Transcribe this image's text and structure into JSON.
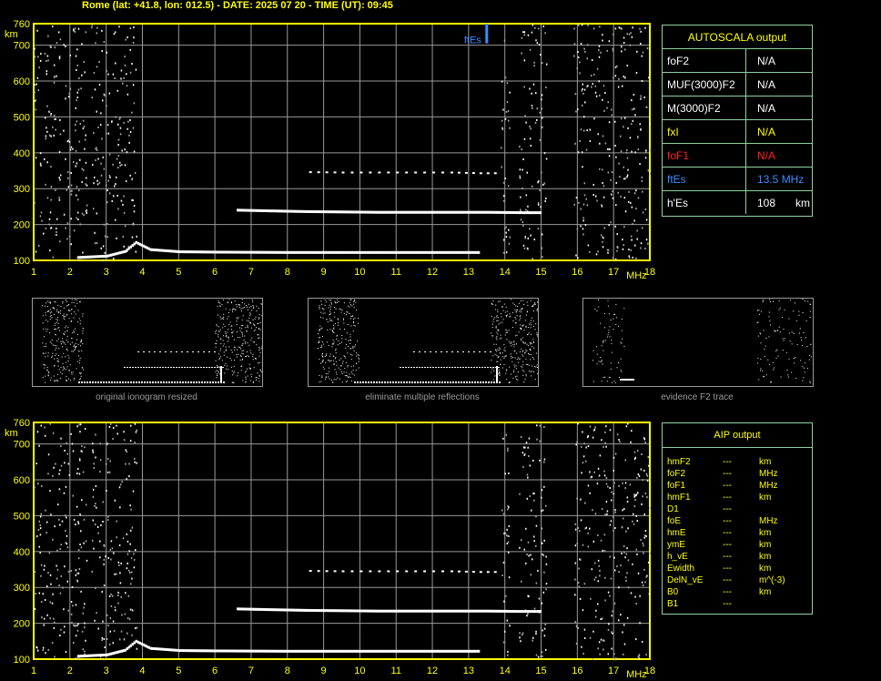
{
  "header": {
    "title": "Rome (lat: +41.8, lon: 012.5) - DATE: 2025 07 20 - TIME (UT): 09:45"
  },
  "colors": {
    "axis": "#ffff00",
    "grid": "#9a9a9a",
    "panel_border": "#8fd19e",
    "red": "#ff2020",
    "blue": "#3a8cff"
  },
  "autoscala": {
    "title": "AUTOSCALA output",
    "rows": [
      {
        "label": "foF2",
        "value": "N/A",
        "unit": "",
        "color": "#ffffff"
      },
      {
        "label": "MUF(3000)F2",
        "value": "N/A",
        "unit": "",
        "color": "#ffffff"
      },
      {
        "label": "M(3000)F2",
        "value": "N/A",
        "unit": "",
        "color": "#ffffff"
      },
      {
        "label": "fxI",
        "value": "N/A",
        "unit": "",
        "color": "#ffff00"
      },
      {
        "label": "foF1",
        "value": "N/A",
        "unit": "",
        "color": "#ff2020"
      },
      {
        "label": "ftEs",
        "value": "13.5 MHz",
        "unit": "",
        "color": "#3a8cff"
      },
      {
        "label": "h'Es",
        "value": "108",
        "unit": "km",
        "color": "#ffffff"
      }
    ]
  },
  "aip": {
    "title": "AIP output",
    "rows": [
      {
        "name": "hmF2",
        "value": "---",
        "unit": "km"
      },
      {
        "name": "foF2",
        "value": "---",
        "unit": "MHz"
      },
      {
        "name": "foF1",
        "value": "---",
        "unit": "MHz"
      },
      {
        "name": "hmF1",
        "value": "---",
        "unit": "km"
      },
      {
        "name": "D1",
        "value": "---",
        "unit": ""
      },
      {
        "name": "foE",
        "value": "---",
        "unit": "MHz"
      },
      {
        "name": "hmE",
        "value": "---",
        "unit": "km"
      },
      {
        "name": "ymE",
        "value": "---",
        "unit": "km"
      },
      {
        "name": "h_vE",
        "value": "---",
        "unit": "km"
      },
      {
        "name": "Ewidth",
        "value": "---",
        "unit": "km"
      },
      {
        "name": "DelN_vE",
        "value": "---",
        "unit": "m^(-3)"
      },
      {
        "name": "B0",
        "value": "---",
        "unit": "km"
      },
      {
        "name": "B1",
        "value": "---",
        "unit": ""
      }
    ]
  },
  "thumbnails": [
    {
      "caption": "original ionogram resized"
    },
    {
      "caption": "eliminate multiple reflections"
    },
    {
      "caption": "evidence F2 trace"
    }
  ],
  "chart_data": [
    {
      "type": "scatter",
      "panel": "autoscala-ionogram",
      "xlabel": "MHz",
      "ylabel": "km",
      "xlim": [
        1,
        18
      ],
      "ylim": [
        100,
        760
      ],
      "x_ticks": [
        1,
        2,
        3,
        4,
        5,
        6,
        7,
        8,
        9,
        10,
        11,
        12,
        13,
        14,
        15,
        16,
        17,
        18
      ],
      "y_ticks": [
        100,
        200,
        300,
        400,
        500,
        600,
        700,
        760
      ],
      "grid": true,
      "annotations": [
        {
          "text": "ftEs",
          "x": 13.5,
          "y": 700
        }
      ],
      "series": [
        {
          "values_x": [
            2.2,
            3.0,
            3.5,
            3.8,
            4.2,
            5.0,
            6.0,
            8.0,
            10.0,
            12.0,
            13.3
          ],
          "values_y": [
            108,
            112,
            125,
            150,
            130,
            124,
            123,
            122,
            122,
            122,
            122
          ]
        },
        {
          "values_x": [
            6.6,
            7.5,
            8.5,
            9.5,
            10.5,
            11.5,
            12.5,
            13.5,
            14.5,
            15.0
          ],
          "values_y": [
            240,
            238,
            236,
            235,
            234,
            234,
            234,
            234,
            233,
            233
          ]
        },
        {
          "values_x": [
            8.6,
            9.5,
            10.5,
            11.5,
            12.5,
            13.3,
            13.9
          ],
          "values_y": [
            346,
            345,
            345,
            345,
            345,
            343,
            343
          ]
        }
      ]
    },
    {
      "type": "scatter",
      "panel": "aip-ionogram",
      "xlabel": "MHz",
      "ylabel": "km",
      "xlim": [
        1,
        18
      ],
      "ylim": [
        100,
        760
      ],
      "x_ticks": [
        1,
        2,
        3,
        4,
        5,
        6,
        7,
        8,
        9,
        10,
        11,
        12,
        13,
        14,
        15,
        16,
        17,
        18
      ],
      "y_ticks": [
        100,
        200,
        300,
        400,
        500,
        600,
        700,
        760
      ],
      "grid": true,
      "series": [
        {
          "values_x": [
            2.2,
            3.0,
            3.5,
            3.8,
            4.2,
            5.0,
            6.0,
            8.0,
            10.0,
            12.0,
            13.3
          ],
          "values_y": [
            108,
            112,
            125,
            150,
            130,
            124,
            123,
            122,
            122,
            122,
            122
          ]
        },
        {
          "values_x": [
            6.6,
            7.5,
            8.5,
            9.5,
            10.5,
            11.5,
            12.5,
            13.5,
            14.5,
            15.0
          ],
          "values_y": [
            240,
            238,
            236,
            235,
            234,
            234,
            234,
            234,
            233,
            233
          ]
        },
        {
          "values_x": [
            8.6,
            9.5,
            10.5,
            11.5,
            12.5,
            13.3,
            13.9
          ],
          "values_y": [
            346,
            345,
            345,
            345,
            345,
            343,
            343
          ]
        }
      ]
    }
  ]
}
